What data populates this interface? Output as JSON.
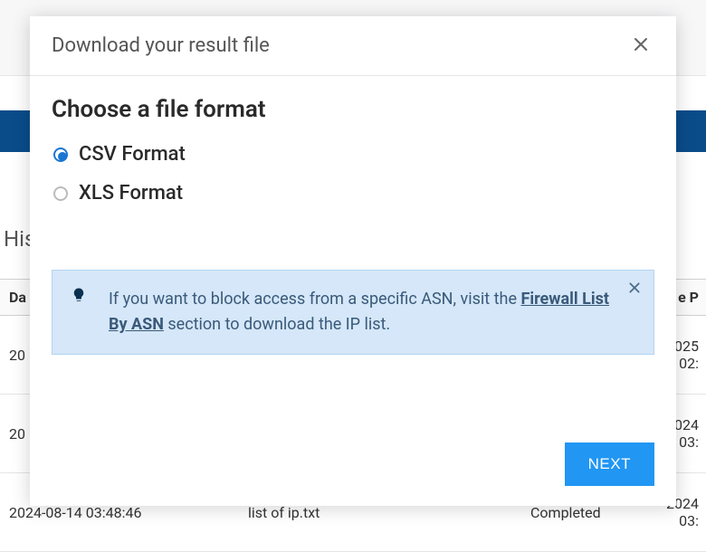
{
  "background": {
    "history_label_fragment": "His",
    "table": {
      "headers": {
        "date": "Da",
        "date_processed": "e P"
      },
      "rows": [
        {
          "date": "20",
          "proc": "2025\n02:"
        },
        {
          "date": "20",
          "proc": "2024\n03:"
        },
        {
          "date": "2024-08-14 03:48:46",
          "file": "list of ip.txt",
          "status": "Completed",
          "proc": "2024\n03:"
        }
      ]
    }
  },
  "modal": {
    "title": "Download your result file",
    "section_title": "Choose a file format",
    "options": [
      {
        "label": "CSV Format",
        "checked": true
      },
      {
        "label": "XLS Format",
        "checked": false
      }
    ],
    "info": {
      "prefix": "If you want to block access from a specific ASN, visit the ",
      "link": "Firewall List By ASN",
      "suffix": " section to download the IP list."
    },
    "next_label": "NEXT"
  }
}
